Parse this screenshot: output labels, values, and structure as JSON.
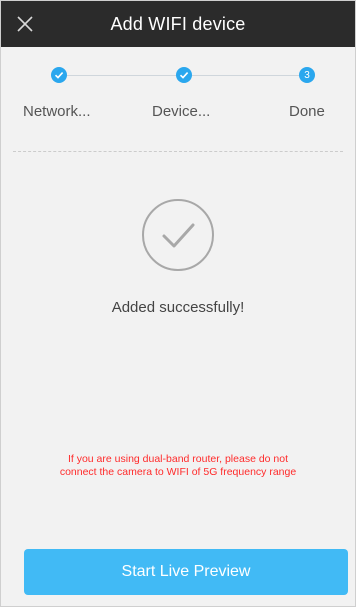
{
  "header": {
    "title": "Add WIFI device",
    "close_icon": "close-icon"
  },
  "steps": [
    {
      "label": "Network...",
      "status": "done",
      "icon": "check-icon"
    },
    {
      "label": "Device...",
      "status": "done",
      "icon": "check-icon"
    },
    {
      "label": "Done",
      "status": "current",
      "number": "3"
    }
  ],
  "result": {
    "icon": "checkmark-circle-icon",
    "message": "Added successfully!"
  },
  "warning": {
    "line1": "If you are using dual-band router, please do not",
    "line2": "connect the camera to WIFI of 5G frequency range"
  },
  "actions": {
    "primary_label": "Start Live Preview"
  },
  "colors": {
    "header_bg": "#2b2b2b",
    "accent": "#2aa7ee",
    "button": "#41baf5",
    "warning": "#ff2b2b"
  }
}
